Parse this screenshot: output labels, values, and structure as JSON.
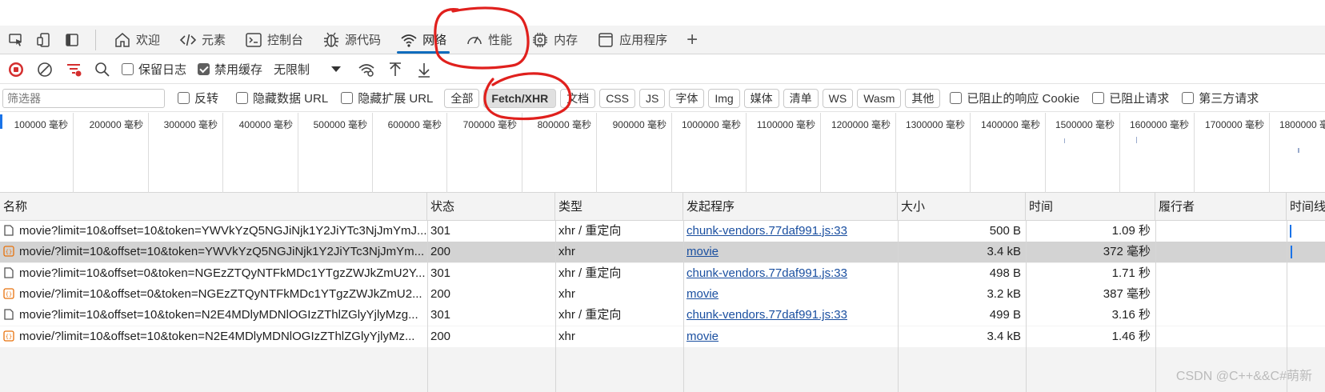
{
  "tabs": {
    "welcome": "欢迎",
    "elements": "元素",
    "console": "控制台",
    "sources": "源代码",
    "network": "网络",
    "performance": "性能",
    "memory": "内存",
    "application": "应用程序",
    "add": "+"
  },
  "toolbar": {
    "preserve_log": "保留日志",
    "disable_cache": "禁用缓存",
    "throttle": "无限制"
  },
  "filter": {
    "placeholder": "筛选器",
    "invert": "反转",
    "hide_data_urls": "隐藏数据 URL",
    "hide_ext_urls": "隐藏扩展 URL",
    "types": [
      "全部",
      "Fetch/XHR",
      "文档",
      "CSS",
      "JS",
      "字体",
      "Img",
      "媒体",
      "清单",
      "WS",
      "Wasm",
      "其他"
    ],
    "blocked_cookies": "已阻止的响应 Cookie",
    "blocked_requests": "已阻止请求",
    "third_party": "第三方请求"
  },
  "overview_ticks": [
    "100000 毫秒",
    "200000 毫秒",
    "300000 毫秒",
    "400000 毫秒",
    "500000 毫秒",
    "600000 毫秒",
    "700000 毫秒",
    "800000 毫秒",
    "900000 毫秒",
    "1000000 毫秒",
    "1100000 毫秒",
    "1200000 毫秒",
    "1300000 毫秒",
    "1400000 毫秒",
    "1500000 毫秒",
    "1600000 毫秒",
    "1700000 毫秒",
    "1800000 毫秒"
  ],
  "columns": {
    "name": "名称",
    "status": "状态",
    "type": "类型",
    "initiator": "发起程序",
    "size": "大小",
    "time": "时间",
    "fulfilled": "履行者",
    "waterfall": "时间线"
  },
  "rows": [
    {
      "name": "movie?limit=10&offset=10&token=YWVkYzQ5NGJiNjk1Y2JiYTc3NjJmYmJ...",
      "status": "301",
      "type": "xhr / 重定向",
      "initiator": "chunk-vendors.77daf991.js:33",
      "size": "500 B",
      "time": "1.09 秒",
      "icon": "doc-icon"
    },
    {
      "name": "movie/?limit=10&offset=10&token=YWVkYzQ5NGJiNjk1Y2JiYTc3NjJmYm...",
      "status": "200",
      "type": "xhr",
      "initiator": "movie",
      "size": "3.4 kB",
      "time": "372  毫秒",
      "icon": "xhr-icon"
    },
    {
      "name": "movie?limit=10&offset=0&token=NGEzZTQyNTFkMDc1YTgzZWJkZmU2Y...",
      "status": "301",
      "type": "xhr / 重定向",
      "initiator": "chunk-vendors.77daf991.js:33",
      "size": "498 B",
      "time": "1.71 秒",
      "icon": "doc-icon"
    },
    {
      "name": "movie/?limit=10&offset=0&token=NGEzZTQyNTFkMDc1YTgzZWJkZmU2...",
      "status": "200",
      "type": "xhr",
      "initiator": "movie",
      "size": "3.2 kB",
      "time": "387  毫秒",
      "icon": "xhr-icon"
    },
    {
      "name": "movie?limit=10&offset=10&token=N2E4MDlyMDNlOGIzZThlZGlyYjlyMzg...",
      "status": "301",
      "type": "xhr / 重定向",
      "initiator": "chunk-vendors.77daf991.js:33",
      "size": "499 B",
      "time": "3.16 秒",
      "icon": "doc-icon"
    },
    {
      "name": "movie/?limit=10&offset=10&token=N2E4MDlyMDNlOGIzZThlZGlyYjlyMz...",
      "status": "200",
      "type": "xhr",
      "initiator": "movie",
      "size": "3.4 kB",
      "time": "1.46 秒",
      "icon": "xhr-icon"
    }
  ],
  "watermark": "CSDN @C++&&C#萌新",
  "colors": {
    "accent": "#0f6cbd",
    "annotation": "#e0201d",
    "link": "#1a4fa0",
    "record": "#d42e2e"
  }
}
